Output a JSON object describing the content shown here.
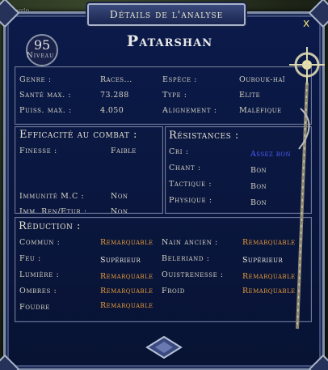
{
  "world": {
    "nameplate": "Samorrin"
  },
  "window": {
    "title": "Détails de l'analyse",
    "close_label": "x",
    "level": {
      "value": "95",
      "label": "Niveau"
    },
    "target_name": "Patarshan"
  },
  "info": {
    "genre": {
      "label": "Genre :",
      "value": "Races..."
    },
    "espece": {
      "label": "Espèce :",
      "value": "Ourouk-haï"
    },
    "sante": {
      "label": "Santé max. :",
      "value": "73.288"
    },
    "type": {
      "label": "Type :",
      "value": "Elite"
    },
    "puiss": {
      "label": "Puiss. max. :",
      "value": "4.050"
    },
    "alignement": {
      "label": "Alignement :",
      "value": "Maléfique"
    }
  },
  "combat": {
    "header": "Efficacité au combat :",
    "finesse": {
      "label": "Finesse :",
      "value": "Faible"
    },
    "immunite": {
      "label": "Immunité M.C :",
      "value": "Non"
    },
    "cutoff": {
      "label": "Imm. Ren/Etur :",
      "value": "Non"
    }
  },
  "resistances": {
    "header": "Résistances :",
    "rows": [
      {
        "label": "Cri :",
        "value": "Assez bon"
      },
      {
        "label": "Chant :",
        "value": "Bon"
      },
      {
        "label": "Tactique :",
        "value": "Bon"
      },
      {
        "label": "Physique :",
        "value": "Bon"
      }
    ]
  },
  "reduction": {
    "header": "Réduction :",
    "left": [
      {
        "label": "Commun :",
        "value": "Remarquable"
      },
      {
        "label": "Feu :",
        "value": "Supérieur"
      },
      {
        "label": "Lumière :",
        "value": "Remarquable"
      },
      {
        "label": "Ombres :",
        "value": "Remarquable"
      },
      {
        "label": "Foudre",
        "value": "Remarquable"
      }
    ],
    "right": [
      {
        "label": "Nain ancien :",
        "value": "Remarquable"
      },
      {
        "label": "Beleriand :",
        "value": "Supérieur"
      },
      {
        "label": "Ouistrenesse :",
        "value": "Remarquable"
      },
      {
        "label": "Froid",
        "value": "Remarquable"
      }
    ]
  },
  "colors": {
    "remarquable": "#e69a3a",
    "superieur": "#ecebe2",
    "assez_bon": "#4d5cff",
    "panel_bg": "#0a1740"
  }
}
